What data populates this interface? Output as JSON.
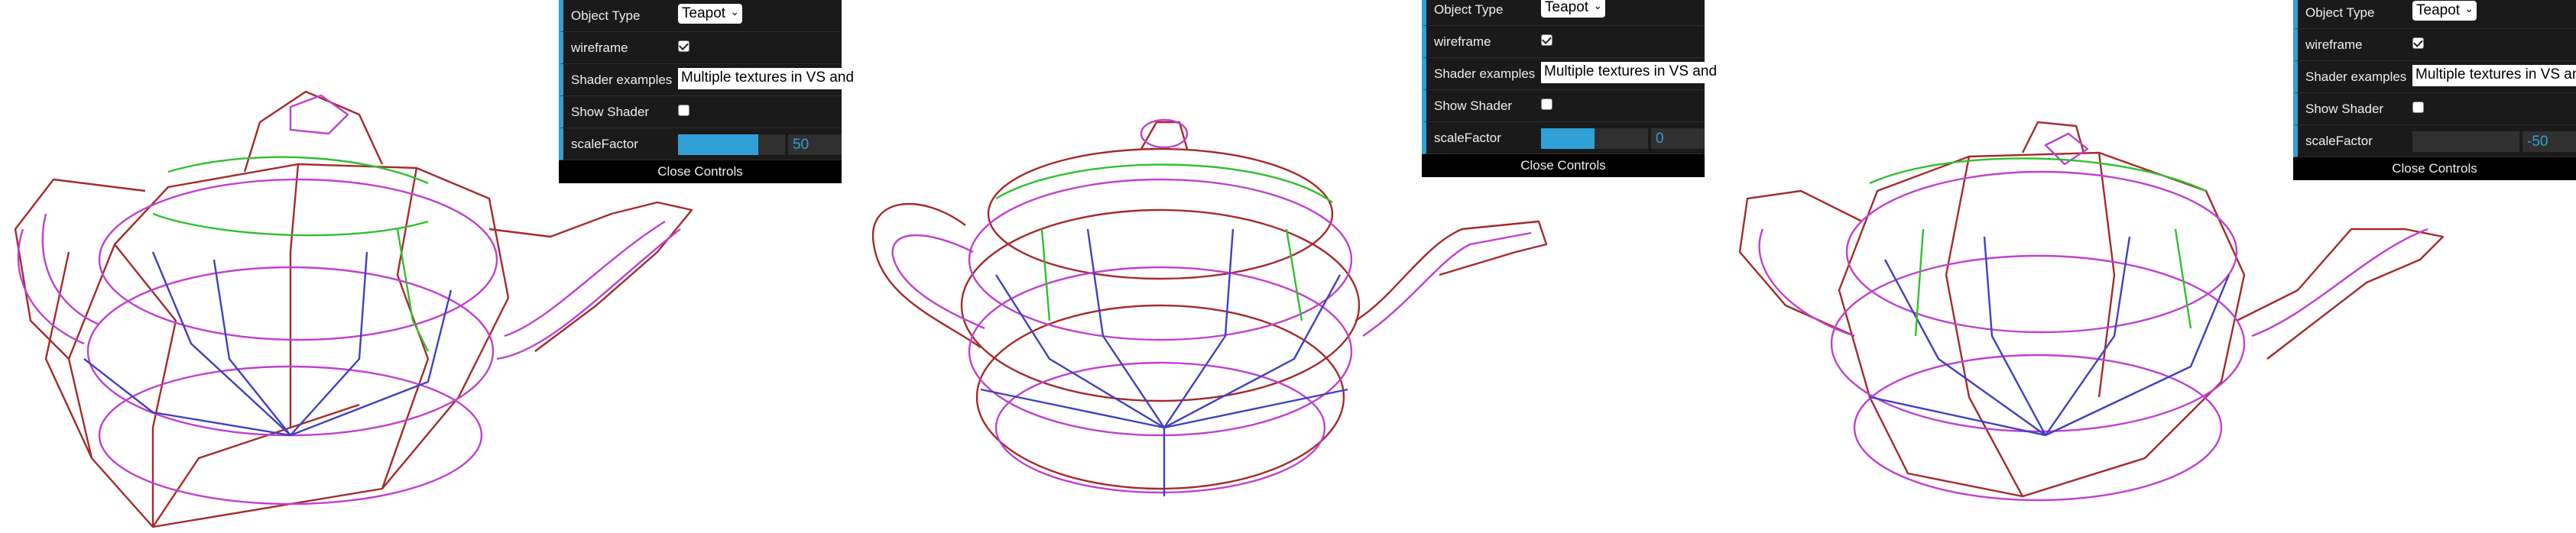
{
  "panels": [
    {
      "object_type_label": "Object Type",
      "object_type_value": "Teapot",
      "wireframe_label": "wireframe",
      "wireframe_checked": true,
      "shader_examples_label": "Shader examples",
      "shader_examples_value": "Multiple textures in VS and FS",
      "show_shader_label": "Show Shader",
      "show_shader_checked": false,
      "scale_factor_label": "scaleFactor",
      "scale_factor_value": "50",
      "scale_factor_fraction": 0.75,
      "close_label": "Close Controls"
    },
    {
      "object_type_label": "Object Type",
      "object_type_value": "Teapot",
      "wireframe_label": "wireframe",
      "wireframe_checked": true,
      "shader_examples_label": "Shader examples",
      "shader_examples_value": "Multiple textures in VS and FS",
      "show_shader_label": "Show Shader",
      "show_shader_checked": false,
      "scale_factor_label": "scaleFactor",
      "scale_factor_value": "0",
      "scale_factor_fraction": 0.5,
      "close_label": "Close Controls"
    },
    {
      "object_type_label": "Object Type",
      "object_type_value": "Teapot",
      "wireframe_label": "wireframe",
      "wireframe_checked": true,
      "shader_examples_label": "Shader examples",
      "shader_examples_value": "Multiple textures in VS and FS",
      "show_shader_label": "Show Shader",
      "show_shader_checked": false,
      "scale_factor_label": "scaleFactor",
      "scale_factor_value": "-50",
      "scale_factor_fraction": 0.0,
      "close_label": "Close Controls"
    }
  ],
  "wire_colors": [
    "#a52a2a",
    "#c040d0",
    "#4040c0",
    "#30c030",
    "#e070e0"
  ]
}
